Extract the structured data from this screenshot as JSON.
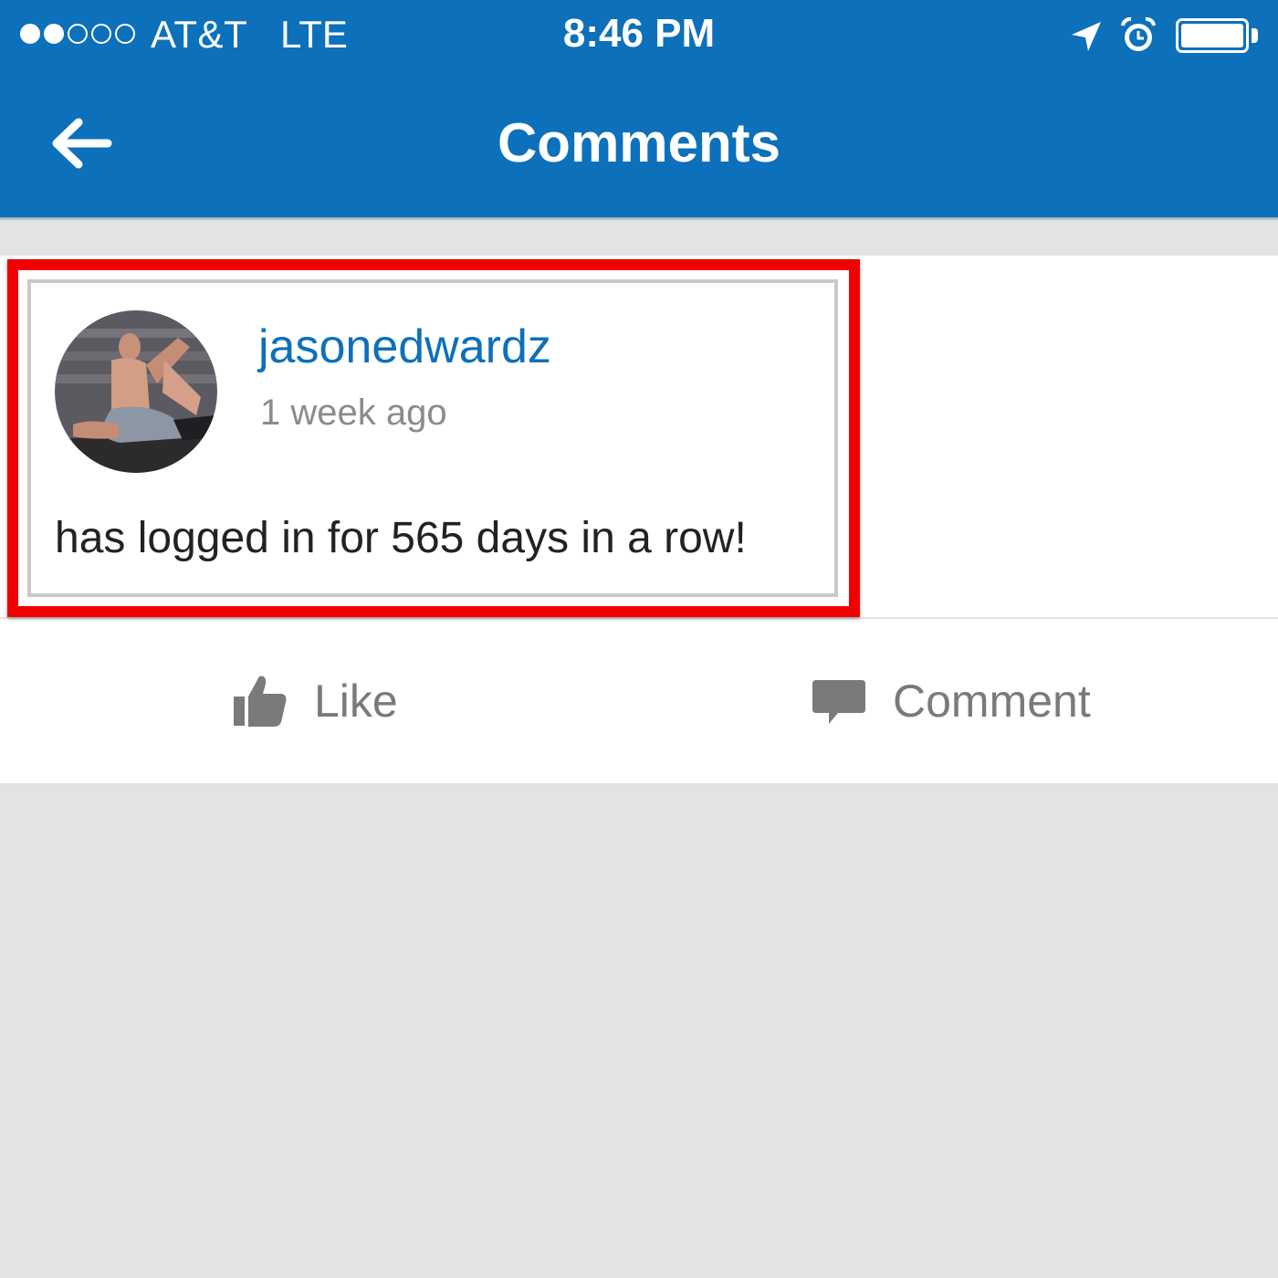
{
  "status_bar": {
    "signal_filled": 2,
    "signal_total": 5,
    "carrier": "AT&T",
    "network": "LTE",
    "time": "8:46 PM",
    "icons": [
      "location-arrow-icon",
      "alarm-clock-icon",
      "battery-icon"
    ],
    "battery_level": 1.0
  },
  "header": {
    "back_icon": "back-arrow-icon",
    "title": "Comments",
    "color": "#0d70ba"
  },
  "post": {
    "avatar_icon": "user-avatar",
    "username": "jasonedwardz",
    "timestamp": "1 week ago",
    "text": "has logged in for 565 days in a row!",
    "highlight_color": "#f20000"
  },
  "actions": {
    "like_label": "Like",
    "like_icon": "thumbs-up-icon",
    "comment_label": "Comment",
    "comment_icon": "speech-bubble-icon",
    "color": "#7a7a7a"
  }
}
